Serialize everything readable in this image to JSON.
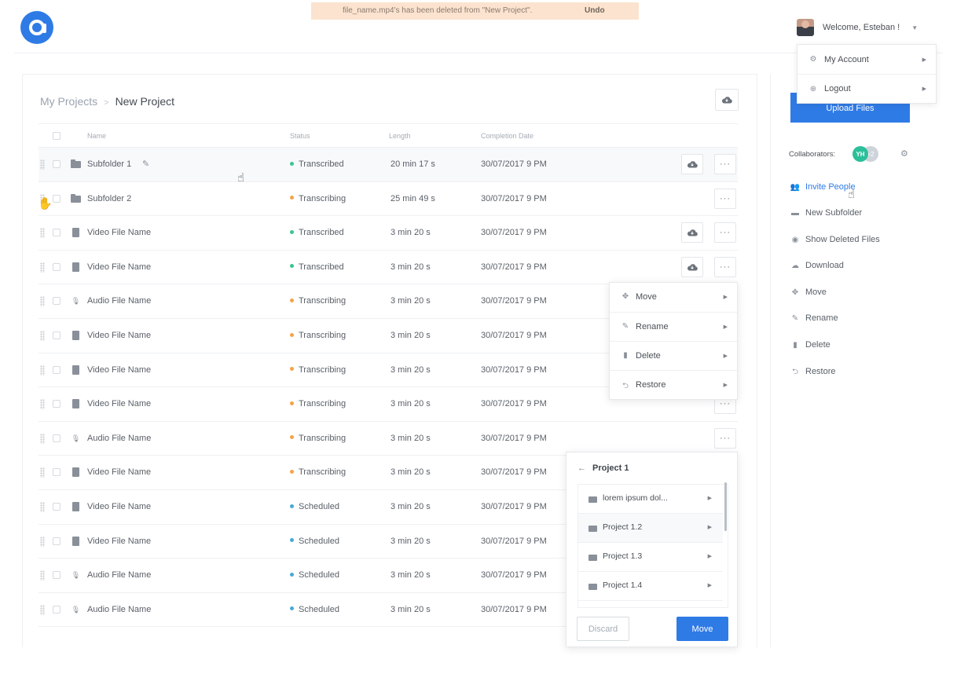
{
  "toast": {
    "message": "file_name.mp4's has been deleted from \"New Project\".",
    "undo": "Undo"
  },
  "user": {
    "welcome": "Welcome, Esteban !",
    "menu": [
      {
        "label": "My Account",
        "icon": "gear-icon"
      },
      {
        "label": "Logout",
        "icon": "logout-icon"
      }
    ]
  },
  "breadcrumb": {
    "root": "My Projects",
    "separator": ">",
    "current": "New Project"
  },
  "table": {
    "headers": {
      "name": "Name",
      "status": "Status",
      "length": "Length",
      "completion": "Completion Date"
    },
    "rows": [
      {
        "type": "folder",
        "name": "Subfolder 1",
        "status": "Transcribed",
        "length": "20 min 17 s",
        "date": "30/07/2017  9 PM",
        "cloud": true,
        "more": true
      },
      {
        "type": "folder",
        "name": "Subfolder 2",
        "status": "Transcribing",
        "length": "25 min 49 s",
        "date": "30/07/2017  9 PM",
        "cloud": false,
        "more": true
      },
      {
        "type": "video",
        "name": "Video File Name",
        "status": "Transcribed",
        "length": "3 min 20 s",
        "date": "30/07/2017  9 PM",
        "cloud": true,
        "more": true
      },
      {
        "type": "video",
        "name": "Video File Name",
        "status": "Transcribed",
        "length": "3 min 20 s",
        "date": "30/07/2017  9 PM",
        "cloud": true,
        "more": true
      },
      {
        "type": "audio",
        "name": "Audio File Name",
        "status": "Transcribing",
        "length": "3 min 20 s",
        "date": "30/07/2017  9 PM",
        "cloud": false,
        "more": false
      },
      {
        "type": "video",
        "name": "Video File Name",
        "status": "Transcribing",
        "length": "3 min 20 s",
        "date": "30/07/2017  9 PM",
        "cloud": false,
        "more": false
      },
      {
        "type": "video",
        "name": "Video File Name",
        "status": "Transcribing",
        "length": "3 min 20 s",
        "date": "30/07/2017  9 PM",
        "cloud": false,
        "more": false
      },
      {
        "type": "video",
        "name": "Video File Name",
        "status": "Transcribing",
        "length": "3 min 20 s",
        "date": "30/07/2017  9 PM",
        "cloud": false,
        "more": true
      },
      {
        "type": "audio",
        "name": "Audio File Name",
        "status": "Transcribing",
        "length": "3 min 20 s",
        "date": "30/07/2017  9 PM",
        "cloud": false,
        "more": true
      },
      {
        "type": "video",
        "name": "Video File Name",
        "status": "Transcribing",
        "length": "3 min 20 s",
        "date": "30/07/2017  9 PM",
        "cloud": false,
        "more": false
      },
      {
        "type": "video",
        "name": "Video File Name",
        "status": "Scheduled",
        "length": "3 min 20 s",
        "date": "30/07/2017  9 PM",
        "cloud": false,
        "more": false
      },
      {
        "type": "video",
        "name": "Video File Name",
        "status": "Scheduled",
        "length": "3 min 20 s",
        "date": "30/07/2017  9 PM",
        "cloud": false,
        "more": false
      },
      {
        "type": "audio",
        "name": "Audio File Name",
        "status": "Scheduled",
        "length": "3 min 20 s",
        "date": "30/07/2017  9 PM",
        "cloud": false,
        "more": false
      },
      {
        "type": "audio",
        "name": "Audio File Name",
        "status": "Scheduled",
        "length": "3 min 20 s",
        "date": "30/07/2017  9 PM",
        "cloud": false,
        "more": false
      }
    ]
  },
  "status_colors": {
    "Transcribed": "#3cc48f",
    "Transcribing": "#f5a34a",
    "Scheduled": "#4aa8d8"
  },
  "context_menu": [
    {
      "label": "Move",
      "icon": "move-icon"
    },
    {
      "label": "Rename",
      "icon": "edit-icon"
    },
    {
      "label": "Delete",
      "icon": "trash-icon"
    },
    {
      "label": "Restore",
      "icon": "restore-icon"
    }
  ],
  "move_panel": {
    "title": "Project 1",
    "items": [
      "lorem ipsum dol...",
      "Project 1.2",
      "Project 1.3",
      "Project 1.4"
    ],
    "discard": "Discard",
    "move": "Move"
  },
  "sidebar": {
    "upload": "Upload Files",
    "collaborators_label": "Collaborators:",
    "collaborators": [
      "YH",
      "+2"
    ],
    "actions": [
      {
        "label": "Invite People",
        "icon": "people-icon"
      },
      {
        "label": "New Subfolder",
        "icon": "folder-icon"
      },
      {
        "label": "Show Deleted Files",
        "icon": "eye-icon"
      },
      {
        "label": "Download",
        "icon": "cloud-icon"
      },
      {
        "label": "Move",
        "icon": "move-icon"
      },
      {
        "label": "Rename",
        "icon": "edit-icon"
      },
      {
        "label": "Delete",
        "icon": "trash-icon"
      },
      {
        "label": "Restore",
        "icon": "restore-icon"
      }
    ]
  },
  "colors": {
    "accent": "#2f7be6",
    "toast_bg": "#fbe3cf"
  }
}
